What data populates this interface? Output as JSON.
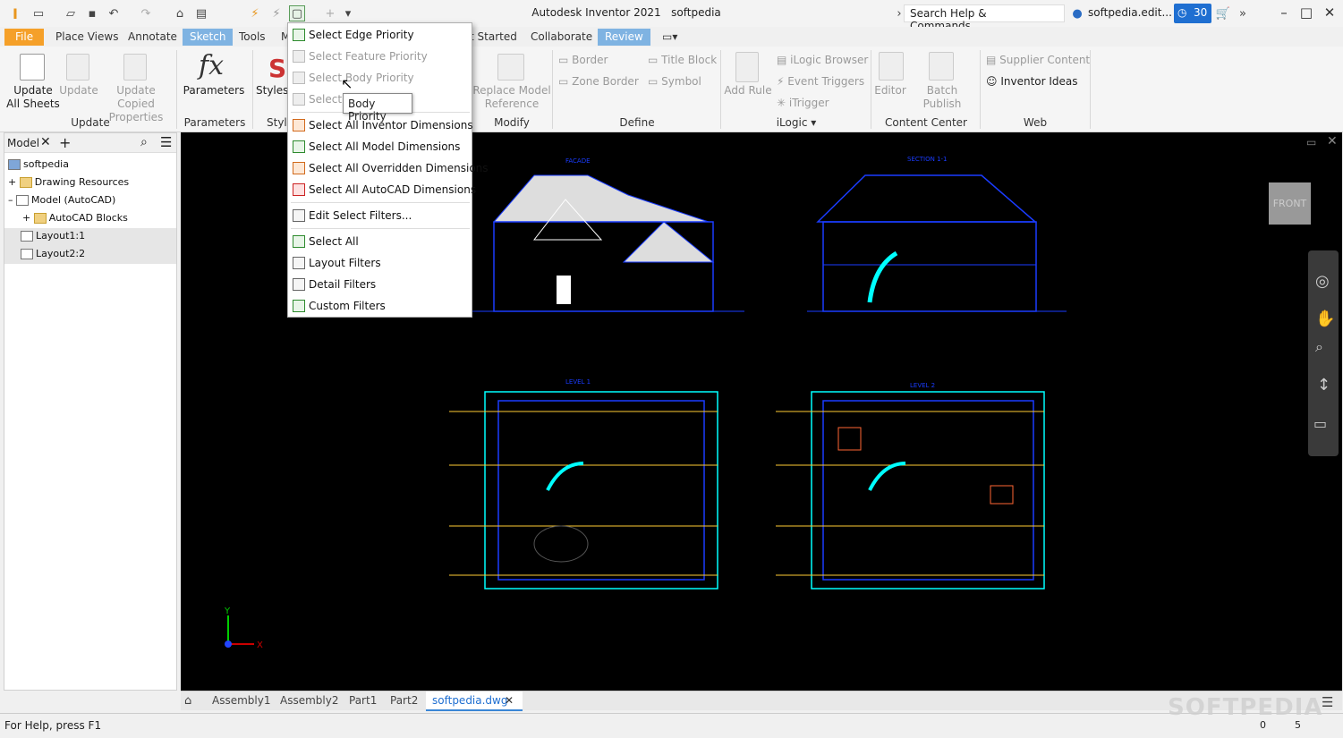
{
  "app": {
    "title": "Autodesk Inventor 2021",
    "document": "softpedia"
  },
  "search": {
    "placeholder": "Search Help & Commands..."
  },
  "user": {
    "name": "softpedia.edit...",
    "trial_days": "30"
  },
  "tabs": [
    "File",
    "Place Views",
    "Annotate",
    "Sketch",
    "Tools",
    "M",
    "t Started",
    "Collaborate",
    "Review"
  ],
  "ribbon": {
    "update": {
      "update_all": "Update All Sheets",
      "update": "Update",
      "update_copied": "Update Copied Properties",
      "title": "Update"
    },
    "parameters": {
      "label": "Parameters",
      "title": "Parameters"
    },
    "styles": {
      "label": "Styles",
      "title": "Style"
    },
    "modify": {
      "replace": "Replace Model Reference",
      "title": "Modify"
    },
    "define": {
      "border": "Border",
      "zone_border": "Zone Border",
      "title_block": "Title Block",
      "symbol": "Symbol",
      "title": "Define"
    },
    "ilogic": {
      "add_rule": "Add Rule",
      "browser": "iLogic Browser",
      "event_triggers": "Event Triggers",
      "itrigger": "iTrigger",
      "title": "iLogic"
    },
    "content_center": {
      "editor": "Editor",
      "batch_publish": "Batch Publish",
      "title": "Content Center"
    },
    "web": {
      "supplier": "Supplier Content",
      "ideas": "Inventor Ideas",
      "title": "Web"
    }
  },
  "browser": {
    "tab": "Model",
    "items": [
      "softpedia",
      "Drawing Resources",
      "Model (AutoCAD)",
      "AutoCAD Blocks",
      "Layout1:1",
      "Layout2:2"
    ]
  },
  "menu": {
    "items": [
      "Select Edge Priority",
      "Select Feature Priority",
      "Select Body Priority",
      "Select F",
      "Select All Inventor Dimensions",
      "Select All Model Dimensions",
      "Select All Overridden Dimensions",
      "Select All AutoCAD Dimensions",
      "Edit Select Filters...",
      "Select All",
      "Layout Filters",
      "Detail Filters",
      "Custom Filters"
    ]
  },
  "tooltip": "Body Priority",
  "viewcube": "FRONT",
  "drawing": {
    "facade": "FACADE",
    "section": "SECTION 1-1",
    "level1": "LEVEL 1",
    "level2": "LEVEL 2"
  },
  "doc_tabs": [
    "Assembly1",
    "Assembly2",
    "Part1",
    "Part2",
    "softpedia.dwg"
  ],
  "status": {
    "help": "For Help, press F1",
    "count1": "0",
    "count2": "5"
  },
  "watermark": "SOFTPEDIA",
  "colors": {
    "accent_file": "#f5a029",
    "tab_active": "#7fb3e2",
    "trial_badge": "#1f6fd1"
  }
}
